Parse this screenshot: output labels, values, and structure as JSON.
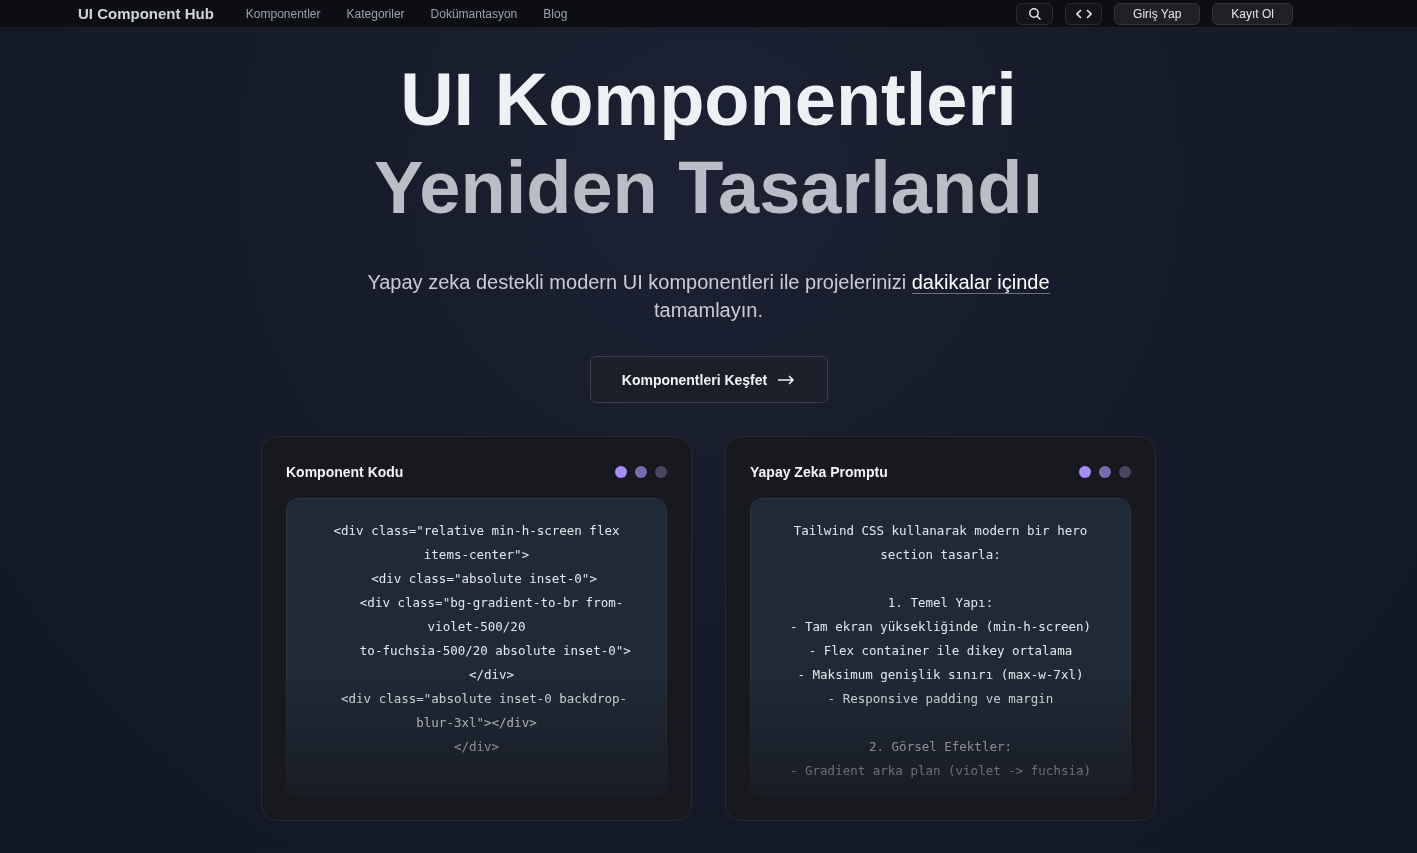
{
  "nav": {
    "brand": "UI Component Hub",
    "links": [
      "Komponentler",
      "Kategoriler",
      "Dokümantasyon",
      "Blog"
    ],
    "buttons": [
      "Giriş Yap",
      "Kayıt Ol"
    ]
  },
  "hero": {
    "title_lines": [
      "UI Komponentleri",
      "Yeniden Tasarlandı"
    ],
    "subtitle": "Yapay zeka destekli modern UI komponentleri ile projelerinizi",
    "subtitle_highlight": "dakikalar içinde",
    "subtitle_end": "tamamlayın.",
    "cta": "Komponentleri Keşfet"
  },
  "cards": [
    {
      "title": "Komponent Kodu",
      "paragraphs": [
        [
          "<div class=\"relative min-h-screen flex items-center\">",
          "  <div class=\"absolute inset-0\">",
          "    <div class=\"bg-gradient-to-br from-violet-500/20",
          "     to-fuchsia-500/20 absolute inset-0\">",
          "    </div>",
          "  <div class=\"absolute inset-0 backdrop-blur-3xl\"></div>",
          "</div>"
        ]
      ]
    },
    {
      "title": "Yapay Zeka Promptu",
      "paragraphs": [
        [
          "Tailwind CSS kullanarak modern bir hero section tasarla:"
        ],
        [
          "1. Temel Yapı:",
          "- Tam ekran yüksekliğinde (min-h-screen)",
          "- Flex container ile dikey ortalama",
          "- Maksimum genişlik sınırı (max-w-7xl)",
          "- Responsive padding ve margin"
        ],
        [
          "2. Görsel Efektler:",
          "- Gradient arka plan (violet -> fuchsia)"
        ]
      ]
    }
  ]
}
